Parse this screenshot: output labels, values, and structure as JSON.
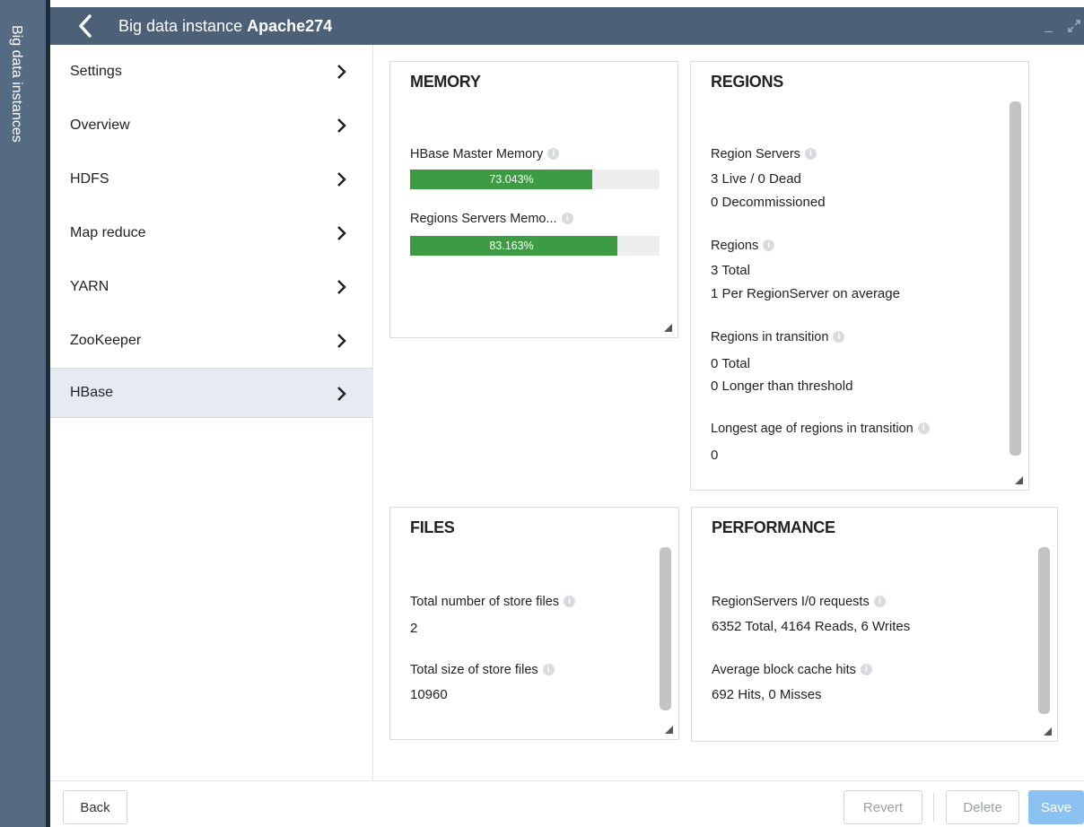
{
  "rail": {
    "label": "Big data instances"
  },
  "header": {
    "title_prefix": "Big data instance",
    "title_name": "Apache274",
    "minimize_icon": "_"
  },
  "nav": {
    "items": [
      {
        "label": "Settings"
      },
      {
        "label": "Overview"
      },
      {
        "label": "HDFS"
      },
      {
        "label": "Map reduce"
      },
      {
        "label": "YARN"
      },
      {
        "label": "ZooKeeper"
      },
      {
        "label": "HBase",
        "active": true
      }
    ]
  },
  "memory": {
    "title": "MEMORY",
    "master_label": "HBase Master Memory",
    "master_value": "73.043%",
    "master_fraction": 0.73043,
    "region_label": "Regions Servers Memo...",
    "region_value": "83.163%",
    "region_fraction": 0.83163
  },
  "regions": {
    "title": "REGIONS",
    "servers_label": "Region Servers",
    "servers_line1": "3 Live / 0 Dead",
    "servers_line2": "0 Decommissioned",
    "regions_label": "Regions",
    "regions_line1": "3 Total",
    "regions_line2": "1 Per RegionServer on average",
    "transition_label": "Regions in transition",
    "transition_line1": "0 Total",
    "transition_line2": "0 Longer than threshold",
    "longest_label": "Longest age of regions in transition",
    "longest_value": "0"
  },
  "files": {
    "title": "FILES",
    "count_label": "Total number of store files",
    "count_value": "2",
    "size_label": "Total size of store files",
    "size_value": "10960"
  },
  "performance": {
    "title": "PERFORMANCE",
    "io_label": "RegionServers I/0 requests",
    "io_value": "6352 Total, 4164 Reads, 6 Writes",
    "cache_label": "Average block cache hits",
    "cache_value": "692 Hits, 0 Misses"
  },
  "footer": {
    "back": "Back",
    "revert": "Revert",
    "delete": "Delete",
    "save": "Save"
  },
  "colors": {
    "header": "#4c6178",
    "rail": "#556b83",
    "bar_fill": "#3d9b43",
    "save_button": "#8cc2f2",
    "nav_active": "#e6ebf2"
  }
}
